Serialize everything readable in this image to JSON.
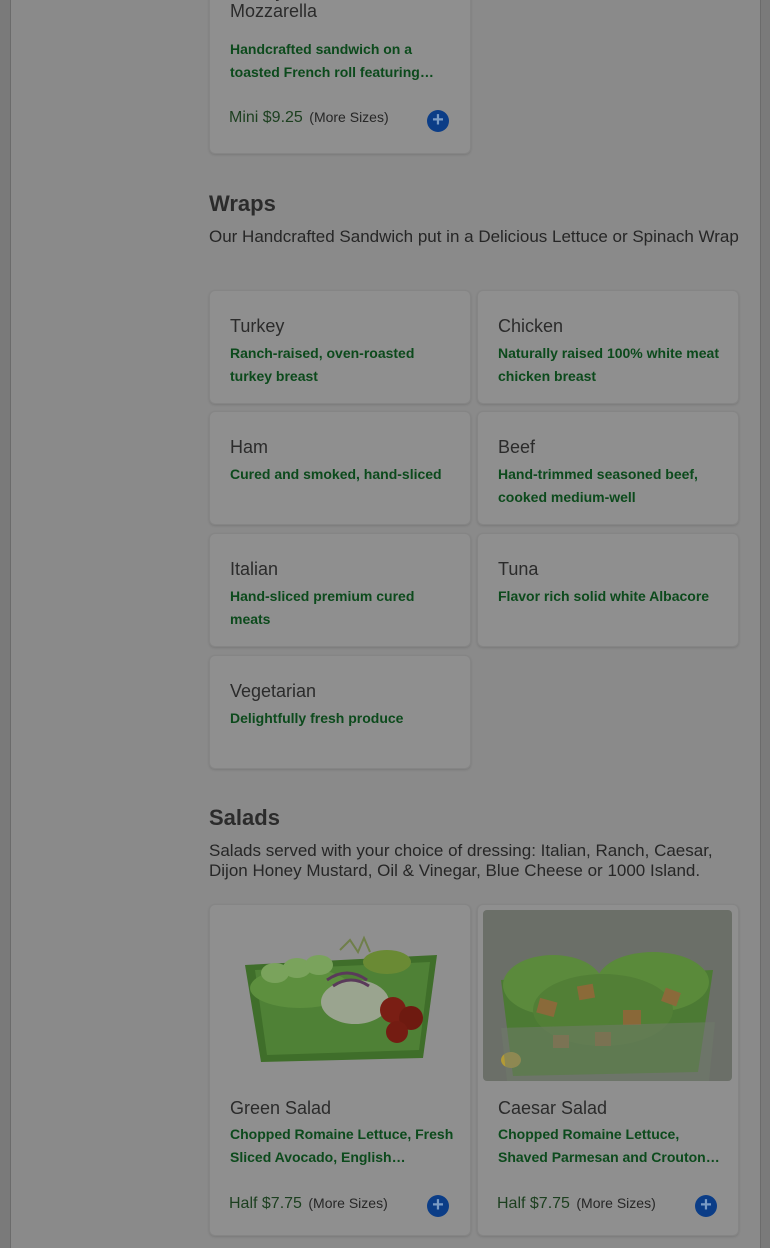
{
  "top_card": {
    "title": "Turkey, Pesto, Avocado, & Mozzarella",
    "description": "Handcrafted sandwich on a toasted French roll featuring turkey, pesto, avocado and mozzarella",
    "price": "Mini $9.25",
    "more": "(More Sizes)"
  },
  "wraps": {
    "title": "Wraps",
    "subtitle": "Our Handcrafted Sandwich put in a Delicious Lettuce or Spinach Wrap",
    "items": [
      {
        "title": "Turkey",
        "description": "Ranch-raised, oven-roasted turkey breast"
      },
      {
        "title": "Chicken",
        "description": "Naturally raised 100% white meat chicken breast"
      },
      {
        "title": "Ham",
        "description": "Cured and smoked, hand-sliced"
      },
      {
        "title": "Beef",
        "description": "Hand-trimmed seasoned beef, cooked medium-well"
      },
      {
        "title": "Italian",
        "description": "Hand-sliced premium cured meats"
      },
      {
        "title": "Tuna",
        "description": "Flavor rich solid white Albacore"
      },
      {
        "title": "Vegetarian",
        "description": "Delightfully fresh produce"
      }
    ]
  },
  "salads": {
    "title": "Salads",
    "subtitle": "Salads served with your choice of dressing: Italian, Ranch, Caesar, Dijon Honey Mustard, Oil & Vinegar, Blue Cheese or 1000 Island.",
    "items": [
      {
        "title": "Green Salad",
        "description": "Chopped Romaine Lettuce, Fresh Sliced Avocado, English Cucumbers, Tomatoes, Red Onions",
        "price": "Half $7.75",
        "more": "(More Sizes)"
      },
      {
        "title": "Caesar Salad",
        "description": "Chopped Romaine Lettuce, Shaved Parmesan and Croutons with Caesar Dressing",
        "price": "Half $7.75",
        "more": "(More Sizes)"
      }
    ]
  },
  "icons": {
    "add": "plus-circle-icon"
  },
  "add_glyph": "+"
}
